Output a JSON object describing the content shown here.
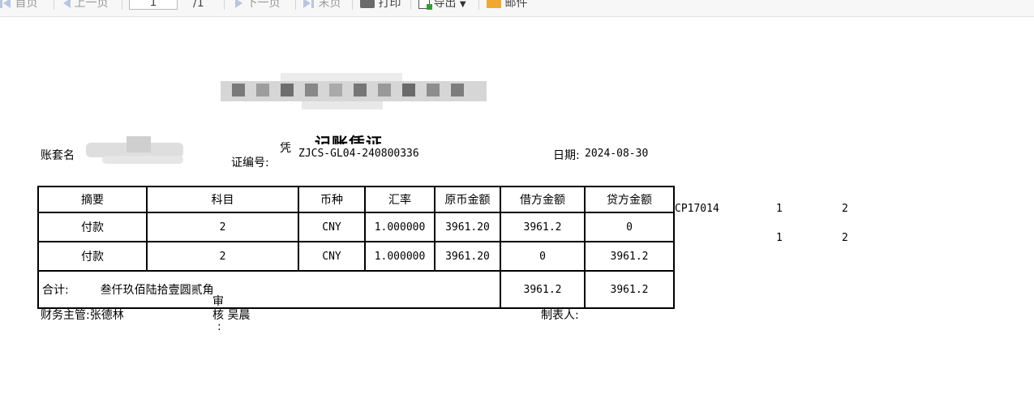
{
  "toolbar": {
    "first_page": "首页",
    "prev_page": "上一页",
    "page_input": "1",
    "page_total": "/1",
    "next_page": "下一页",
    "last_page": "末页",
    "print": "打印",
    "export": "导出",
    "mail": "邮件"
  },
  "voucher": {
    "title": "记账凭证",
    "account_set_label": "账套名",
    "voucher_no_label_top": "凭",
    "voucher_no_label_bottom": "证编号:",
    "voucher_no": "ZJCS-GL04-240800336",
    "date_label": "日期:",
    "date": "2024-08-30",
    "columns": [
      "摘要",
      "科目",
      "币种",
      "汇率",
      "原币金额",
      "借方金额",
      "贷方金额"
    ],
    "rows": [
      {
        "summary": "付款",
        "subject": "2",
        "currency": "CNY",
        "rate": "1.000000",
        "original": "3961.20",
        "debit": "3961.2",
        "credit": "0",
        "extra": [
          "CP17014",
          "1",
          "2"
        ]
      },
      {
        "summary": "付款",
        "subject": "2",
        "currency": "CNY",
        "rate": "1.000000",
        "original": "3961.20",
        "debit": "0",
        "credit": "3961.2",
        "extra": [
          "",
          "1",
          "2"
        ]
      }
    ],
    "total_label": "合计:",
    "total_words": "叁仟玖佰陆拾壹圆贰角",
    "total_debit": "3961.2",
    "total_credit": "3961.2",
    "supervisor_label": "财务主管:",
    "supervisor": "张德林",
    "auditor_label_top": "审",
    "auditor_label_mid": "核",
    "auditor_label_colon": ":",
    "auditor": "吴晨",
    "preparer_label": "制表人:"
  },
  "colors": {
    "toolbar_bg": "#f7f7f7",
    "disabled_text": "#9a9a9a",
    "icon_blue": "#b8c7df",
    "mail_icon": "#f0a830"
  }
}
